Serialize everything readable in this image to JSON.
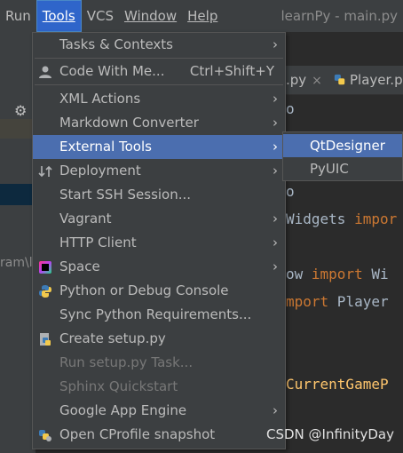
{
  "menubar": {
    "items": [
      "Run",
      "Tools",
      "VCS",
      "Window",
      "Help"
    ],
    "title": "learnPy - main.py"
  },
  "left": {
    "path_text": "ram\\l"
  },
  "tabs": [
    {
      "label": ".py",
      "close": "×"
    },
    {
      "label": "Player.p"
    }
  ],
  "code": {
    "line1": "o",
    "line2": "o",
    "line3_a": "Widgets ",
    "line3_b": "impor",
    "line4_a": "ow ",
    "line4_b": "import",
    "line4_c": " Wi",
    "line5_a": "mport",
    "line5_b": " Player",
    "line6": "CurrentGameP"
  },
  "tools_menu": {
    "items": [
      {
        "label": "Tasks & Contexts",
        "submenu": true,
        "icon": ""
      },
      {
        "label": "Code With Me...",
        "shortcut": "Ctrl+Shift+Y",
        "icon": "user-icon"
      },
      {
        "label": "XML Actions",
        "submenu": true
      },
      {
        "label": "Markdown Converter",
        "submenu": true
      },
      {
        "label": "External Tools",
        "submenu": true,
        "selected": true
      },
      {
        "label": "Deployment",
        "submenu": true,
        "icon": "deployment-icon"
      },
      {
        "label": "Start SSH Session..."
      },
      {
        "label": "Vagrant",
        "submenu": true
      },
      {
        "label": "HTTP Client",
        "submenu": true
      },
      {
        "label": "Space",
        "submenu": true,
        "icon": "space-icon"
      },
      {
        "label": "Python or Debug Console",
        "icon": "python-icon"
      },
      {
        "label": "Sync Python Requirements..."
      },
      {
        "label": "Create setup.py",
        "icon": "python-file-icon"
      },
      {
        "label": "Run setup.py Task...",
        "disabled": true
      },
      {
        "label": "Sphinx Quickstart",
        "disabled": true
      },
      {
        "label": "Google App Engine",
        "submenu": true
      },
      {
        "label": "Open CProfile snapshot",
        "icon": "python-profile-icon"
      }
    ],
    "arrow": "›"
  },
  "external_tools_submenu": {
    "items": [
      {
        "label": "QtDesigner",
        "selected": true
      },
      {
        "label": "PyUIC"
      }
    ]
  },
  "watermark": "CSDN @InfinityDay",
  "colors": {
    "menubar_bg": "#3c3f41",
    "selection": "#4b6eaf",
    "editor_bg": "#2b2b2b",
    "keyword": "#cc7832"
  }
}
